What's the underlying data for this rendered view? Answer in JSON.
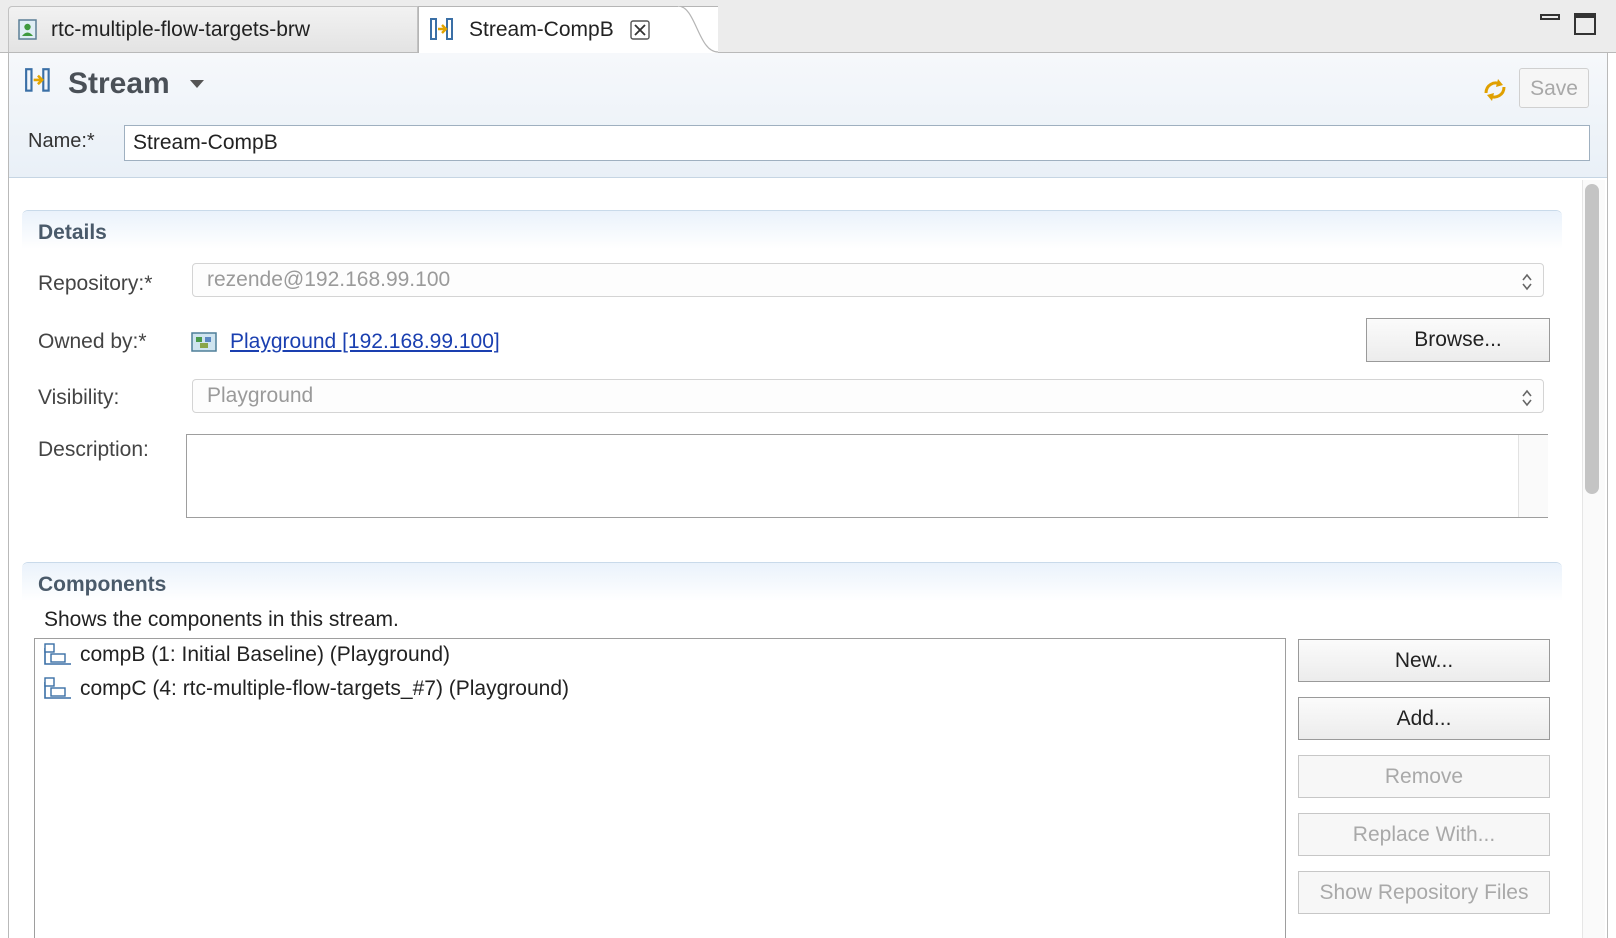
{
  "tabs": [
    {
      "label": "rtc-multiple-flow-targets-brw",
      "icon": "team-area-icon"
    },
    {
      "label": "Stream-CompB",
      "icon": "stream-icon",
      "close_icon": "close-icon"
    }
  ],
  "window_controls": {
    "minimize_icon": "minimize-icon",
    "maximize_icon": "maximize-icon"
  },
  "header": {
    "title": "Stream",
    "title_icon": "stream-icon",
    "sync_icon": "sync-icon",
    "save_label": "Save",
    "name_label": "Name:*",
    "name_value": "Stream-CompB"
  },
  "details": {
    "title": "Details",
    "repository_label": "Repository:*",
    "repository_value": "rezende@192.168.99.100",
    "owned_by_label": "Owned by:*",
    "owned_by_value": "Playground [192.168.99.100]",
    "owned_by_icon": "project-area-icon",
    "browse_label": "Browse...",
    "visibility_label": "Visibility:",
    "visibility_value": "Playground",
    "description_label": "Description:",
    "description_value": ""
  },
  "components": {
    "title": "Components",
    "hint": "Shows the components in this stream.",
    "items": [
      {
        "label": "compB (1: Initial Baseline) (Playground)",
        "icon": "component-icon"
      },
      {
        "label": "compC (4: rtc-multiple-flow-targets_#7) (Playground)",
        "icon": "component-icon"
      }
    ],
    "buttons": {
      "new": "New...",
      "add": "Add...",
      "remove": "Remove",
      "replace": "Replace With...",
      "show_files": "Show Repository Files"
    }
  },
  "colors": {
    "link": "#1a3fb0",
    "section_title": "#4a5a6a",
    "disabled_text": "#a9a9a9"
  }
}
